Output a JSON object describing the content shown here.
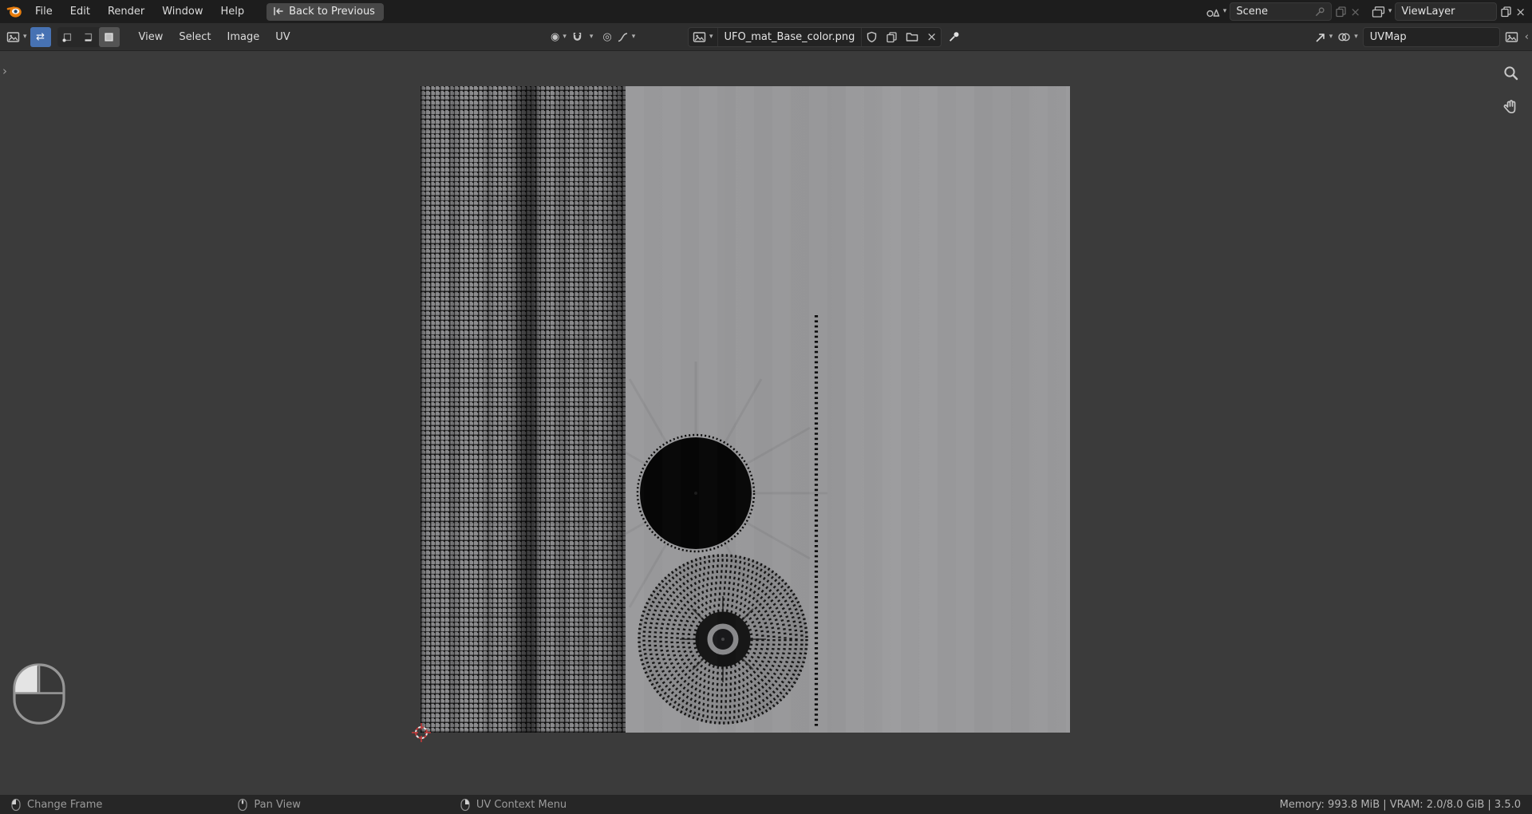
{
  "topbar": {
    "menus": [
      "File",
      "Edit",
      "Render",
      "Window",
      "Help"
    ],
    "back_button": "Back to Previous",
    "scene_field": "Scene",
    "view_layer_field": "ViewLayer"
  },
  "header": {
    "menus": [
      "View",
      "Select",
      "Image",
      "UV"
    ],
    "image_name": "UFO_mat_Base_color.png",
    "uvmap_field": "UVMap"
  },
  "statusbar": {
    "hints": [
      {
        "button": "mouse-left",
        "label": "Change Frame"
      },
      {
        "button": "mouse-middle",
        "label": "Pan View"
      },
      {
        "button": "mouse-right",
        "label": "UV Context Menu"
      }
    ],
    "stats": "Memory: 993.8 MiB | VRAM: 2.0/8.0 GiB | 3.5.0"
  },
  "icons": {
    "chevron_down": "▾",
    "close": "×",
    "pivot": "◉",
    "proportional": "◎",
    "sync_select": "⇄",
    "sidebar_toggle": "›",
    "panel_toggle": "‹"
  },
  "colors": {
    "accent_blue": "#4772b3",
    "uv_area_gray": "#9a9a9c",
    "viewport_bg": "#3b3b3b",
    "topbar_bg": "#1d1d1d"
  }
}
